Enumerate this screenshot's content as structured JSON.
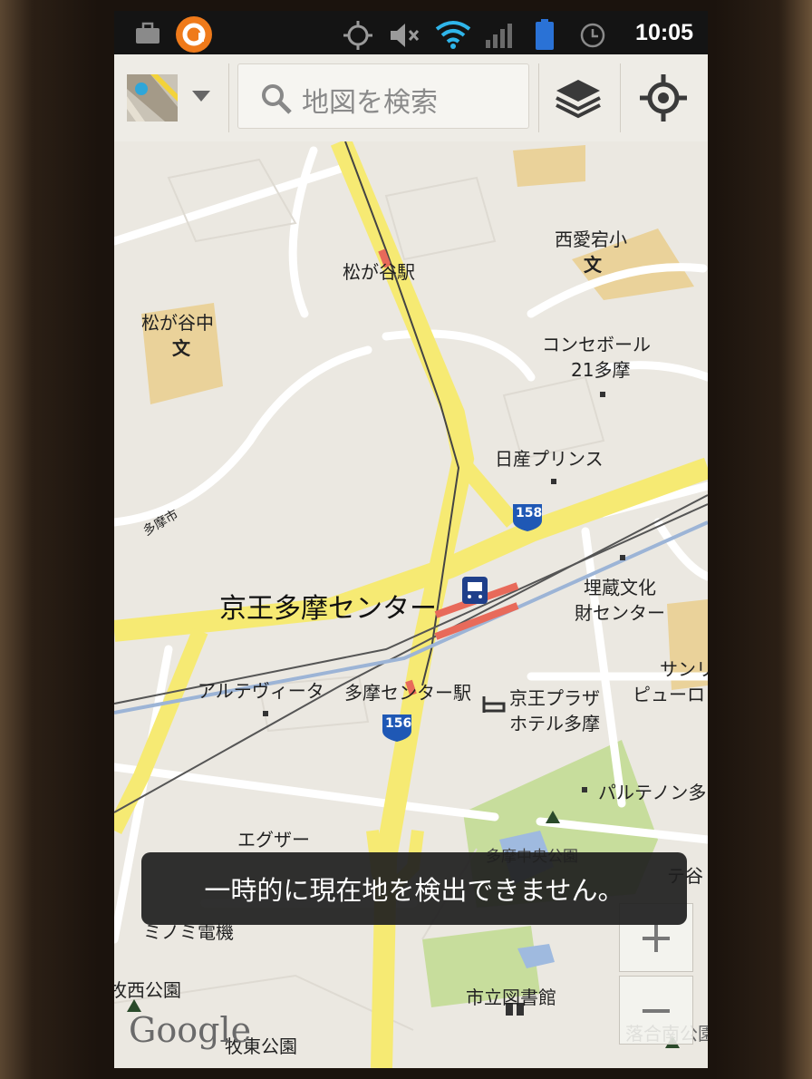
{
  "status_bar": {
    "time": "10:05",
    "icons": [
      "briefcase-icon",
      "app-notification-icon",
      "gps-icon",
      "mute-icon",
      "wifi-icon",
      "signal-icon",
      "battery-icon",
      "alarm-icon"
    ]
  },
  "toolbar": {
    "search_placeholder": "地図を検索",
    "layers_icon": "layers-icon",
    "location_icon": "my-location-icon"
  },
  "map": {
    "labels": {
      "matsugaya_station": "松が谷駅",
      "nishi_aitaka": "西愛宕小",
      "school_symbol": "文",
      "matsugaya_junior": "松が谷中",
      "consebord_1": "コンセボール",
      "consebord_2": "21多摩",
      "nissan_prince": "日産プリンス",
      "route_158": "158",
      "route_156": "156",
      "tama_city": "多摩市",
      "keio_tama_center": "京王多摩センター",
      "maizo_1": "埋蔵文化",
      "maizo_2": "財センター",
      "sanrio_1": "サンリ",
      "sanrio_2": "ピューロ",
      "alteviata": "アルテヴィータ",
      "tama_center_station": "多摩センター駅",
      "keio_plaza_1": "京王プラザ",
      "keio_plaza_2": "ホテル多摩",
      "parthenon": "パルテノン多",
      "egza": "エグザー",
      "minami_denki": "ミノミ電機",
      "nishi_park": "牧西公園",
      "library": "市立図書館",
      "higashi_park": "牧東公園",
      "ochiai_park": "落合南公園",
      "park_partial": "多摩中央公園",
      "te_tani": "テ谷"
    }
  },
  "toast": "一時的に現在地を検出できません。",
  "zoom": {
    "in": "+",
    "out": "−"
  },
  "watermark": "Google"
}
